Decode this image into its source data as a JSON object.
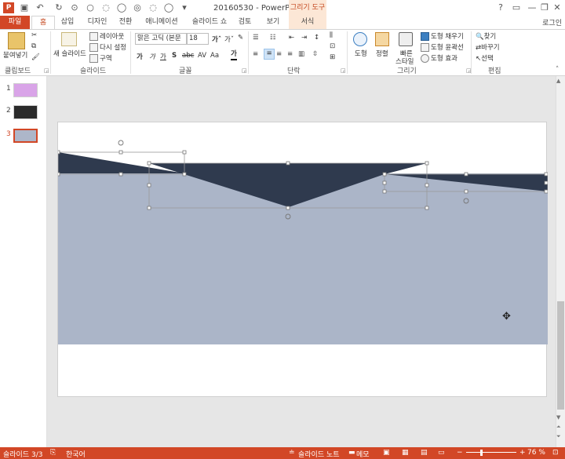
{
  "app": {
    "logo": "P",
    "title": "20160530 - PowerPoint",
    "context_tab": "그리기 도구",
    "login": "로그인"
  },
  "tabs": {
    "file": "파일",
    "home": "홈",
    "insert": "삽입",
    "design": "디자인",
    "transitions": "전환",
    "animations": "애니메이션",
    "slideshow": "슬라이드 쇼",
    "review": "검토",
    "view": "보기",
    "format": "서식"
  },
  "ribbon": {
    "clipboard": {
      "paste": "붙여넣기",
      "label": "클립보드"
    },
    "slides": {
      "new_slide": "새 슬라이드",
      "layout": "레이아웃",
      "reset": "다시 설정",
      "section": "구역",
      "label": "슬라이드"
    },
    "font": {
      "name": "맑은 고딕 (본문",
      "size": "18",
      "case": "Aa",
      "label": "글꼴"
    },
    "paragraph": {
      "label": "단락"
    },
    "drawing": {
      "shapes": "도형",
      "arrange": "정렬",
      "quick_styles_1": "빠른",
      "quick_styles_2": "스타일",
      "fill": "도형 채우기",
      "outline": "도형 윤곽선",
      "effects": "도형 효과",
      "label": "그리기"
    },
    "editing": {
      "find": "찾기",
      "replace": "바꾸기",
      "select": "선택",
      "label": "편집"
    }
  },
  "thumbnails": [
    {
      "num": "1",
      "color": "#d9a4e8"
    },
    {
      "num": "2",
      "color": "#2b2b2b"
    },
    {
      "num": "3",
      "color": "#adb6c9"
    }
  ],
  "slide": {
    "band_color": "#2f3a4e",
    "fill_color": "#abb5c8"
  },
  "status": {
    "slide_count": "슬라이드 3/3",
    "language": "한국어",
    "notes": "슬라이드 노트",
    "comments": "메모",
    "zoom": "76 %"
  }
}
